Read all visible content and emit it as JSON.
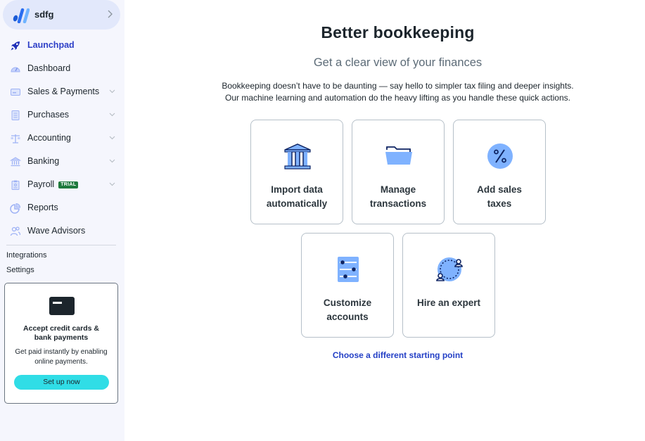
{
  "business": {
    "name": "sdfg"
  },
  "sidebar": {
    "items": [
      {
        "label": "Launchpad",
        "icon": "rocket-icon",
        "active": true,
        "expandable": false
      },
      {
        "label": "Dashboard",
        "icon": "gauge-icon",
        "active": false,
        "expandable": false
      },
      {
        "label": "Sales & Payments",
        "icon": "credit-card-icon",
        "active": false,
        "expandable": true
      },
      {
        "label": "Purchases",
        "icon": "receipt-icon",
        "active": false,
        "expandable": true
      },
      {
        "label": "Accounting",
        "icon": "scale-icon",
        "active": false,
        "expandable": true
      },
      {
        "label": "Banking",
        "icon": "bank-icon",
        "active": false,
        "expandable": true
      },
      {
        "label": "Payroll",
        "icon": "clipboard-icon",
        "active": false,
        "expandable": true,
        "badge": "TRIAL"
      },
      {
        "label": "Reports",
        "icon": "pie-chart-icon",
        "active": false,
        "expandable": false
      },
      {
        "label": "Wave Advisors",
        "icon": "users-icon",
        "active": false,
        "expandable": false
      }
    ],
    "links": [
      {
        "label": "Integrations"
      },
      {
        "label": "Settings"
      }
    ],
    "promo": {
      "title": "Accept credit cards & bank payments",
      "description": "Get paid instantly by enabling online payments.",
      "button": "Set up now",
      "icon": "credit-card-icon"
    }
  },
  "main": {
    "title": "Better bookkeeping",
    "subtitle": "Get a clear view of your finances",
    "description_line1": "Bookkeeping doesn’t have to be daunting — say hello to simpler tax filing and deeper insights.",
    "description_line2": "Our machine learning and automation do the heavy lifting as you handle these quick actions.",
    "tiles": [
      {
        "line1": "Import data",
        "line2": "automatically",
        "icon": "bank-building-icon"
      },
      {
        "line1": "Manage",
        "line2": "transactions",
        "icon": "folder-icon"
      },
      {
        "line1": "Add sales",
        "line2": "taxes",
        "icon": "percent-icon"
      },
      {
        "line1": "Customize",
        "line2": "accounts",
        "icon": "list-settings-icon"
      },
      {
        "line1": "Hire an expert",
        "line2": "",
        "icon": "expert-exchange-icon"
      }
    ],
    "alt_link": "Choose a different starting point"
  },
  "colors": {
    "accent": "#2d3fc7",
    "link": "#2440c6",
    "cta": "#30dde6",
    "icon_fill": "#7fb2ff",
    "icon_stroke": "#0e2463",
    "sidebar_bg": "#f5f6fd",
    "trial_badge": "#1f7a3d"
  }
}
